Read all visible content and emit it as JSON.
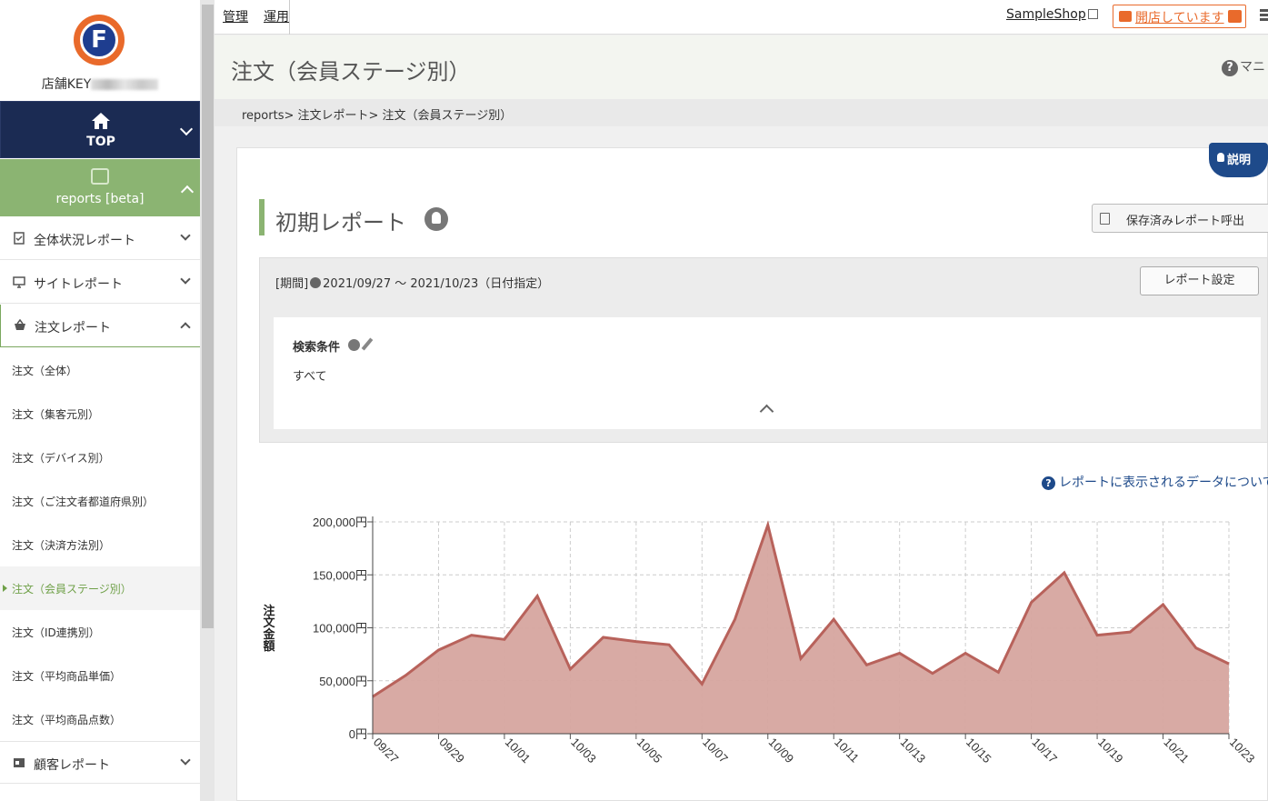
{
  "sidebar": {
    "store_key_label": "店舗KEY",
    "top_label": "TOP",
    "reports_label": "reports [beta]",
    "sections": [
      {
        "label": "全体状況レポート",
        "icon": "clipboard-icon",
        "open": false
      },
      {
        "label": "サイトレポート",
        "icon": "monitor-icon",
        "open": false
      },
      {
        "label": "注文レポート",
        "icon": "basket-icon",
        "open": true
      },
      {
        "label": "顧客レポート",
        "icon": "id-card-icon",
        "open": false
      }
    ],
    "order_items": [
      {
        "label": "注文（全体）"
      },
      {
        "label": "注文（集客元別）"
      },
      {
        "label": "注文（デバイス別）"
      },
      {
        "label": "注文（ご注文者都道府県別）"
      },
      {
        "label": "注文（決済方法別）"
      },
      {
        "label": "注文（会員ステージ別）",
        "active": true
      },
      {
        "label": "注文（ID連携別）"
      },
      {
        "label": "注文（平均商品単価）"
      },
      {
        "label": "注文（平均商品点数）"
      }
    ]
  },
  "topbar": {
    "tabs": [
      "管理",
      "運用"
    ],
    "shop_link": "SampleShop",
    "open_status": "開店しています"
  },
  "page": {
    "title": "注文（会員ステージ別）",
    "manual": "マニ",
    "breadcrumb": "reports> 注文レポート> 注文（会員ステージ別）",
    "help_tab": "説明",
    "report_title": "初期レポート",
    "saved_button": "保存済みレポート呼出",
    "period_prefix": "[期間]",
    "period": "2021/09/27 〜 2021/10/23（日付指定）",
    "settings_button": "レポート設定",
    "conditions_label": "検索条件",
    "conditions_value": "すべて",
    "data_note": "レポートに表示されるデータについて"
  },
  "chart_data": {
    "type": "area",
    "ylabel": "注文金額",
    "xlabel": "",
    "ylim": [
      0,
      200000
    ],
    "yticks": [
      "0円",
      "50,000円",
      "100,000円",
      "150,000円",
      "200,000円"
    ],
    "x": [
      "09/27",
      "09/28",
      "09/29",
      "09/30",
      "10/01",
      "10/02",
      "10/03",
      "10/04",
      "10/05",
      "10/06",
      "10/07",
      "10/08",
      "10/09",
      "10/10",
      "10/11",
      "10/12",
      "10/13",
      "10/14",
      "10/15",
      "10/16",
      "10/17",
      "10/18",
      "10/19",
      "10/20",
      "10/21",
      "10/22",
      "10/23"
    ],
    "xtick_labels": [
      "09/27",
      "09/29",
      "10/01",
      "10/03",
      "10/05",
      "10/07",
      "10/09",
      "10/11",
      "10/13",
      "10/15",
      "10/17",
      "10/19",
      "10/21",
      "10/23"
    ],
    "series": [
      {
        "values": [
          35000,
          55000,
          79000,
          93000,
          89000,
          130000,
          61000,
          91000,
          87000,
          84000,
          47000,
          108000,
          197000,
          71000,
          108000,
          65000,
          76000,
          57000,
          76000,
          58000,
          124000,
          152000,
          93000,
          96000,
          122000,
          81000,
          66000
        ]
      }
    ],
    "fill_color": "#d6a59f",
    "line_color": "#b8625b",
    "grid": true
  }
}
